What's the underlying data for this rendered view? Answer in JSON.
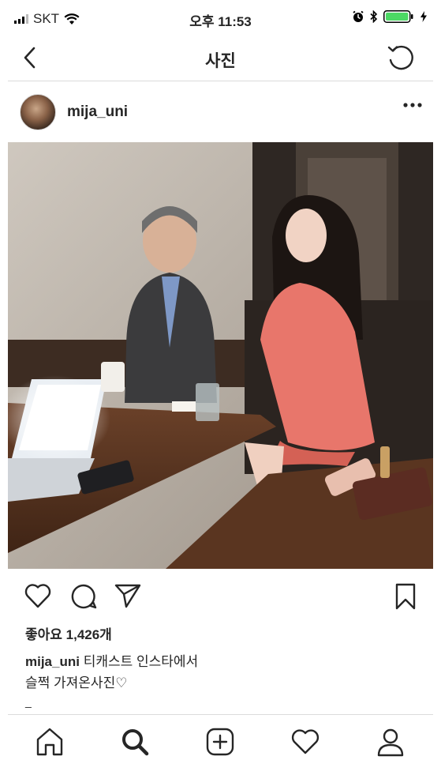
{
  "status_bar": {
    "carrier": "SKT",
    "time": "오후 11:53"
  },
  "nav": {
    "title": "사진"
  },
  "post": {
    "username": "mija_uni",
    "likes_text": "좋아요 1,426개",
    "caption_user": "mija_uni",
    "caption_line1": " 티캐스트 인스타에서",
    "caption_line2": "슬쩍 가져온사진♡",
    "more_hint": "_"
  },
  "icons": {
    "back": "chevron-left-icon",
    "refresh": "refresh-icon",
    "more": "more-icon",
    "like": "heart-icon",
    "comment": "comment-icon",
    "share": "send-icon",
    "save": "bookmark-icon"
  },
  "tabs": [
    {
      "name": "home",
      "icon": "home-icon"
    },
    {
      "name": "search",
      "icon": "search-icon"
    },
    {
      "name": "add",
      "icon": "add-icon"
    },
    {
      "name": "activity",
      "icon": "heart-icon"
    },
    {
      "name": "profile",
      "icon": "profile-icon"
    }
  ],
  "colors": {
    "battery": "#4cd964",
    "border": "#dbdbdb",
    "text": "#262626"
  }
}
